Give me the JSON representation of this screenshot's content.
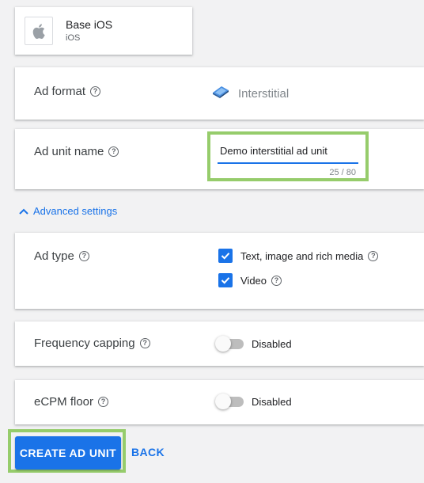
{
  "app": {
    "name": "Base iOS",
    "platform": "iOS",
    "icon": "apple-icon"
  },
  "ad_format": {
    "label": "Ad format",
    "value": "Interstitial",
    "icon": "interstitial-icon"
  },
  "ad_unit_name": {
    "label": "Ad unit name",
    "value": "Demo interstitial ad unit",
    "counter": "25 / 80"
  },
  "advanced_settings": {
    "label": "Advanced settings"
  },
  "ad_type": {
    "label": "Ad type",
    "options": [
      {
        "label": "Text, image and rich media",
        "checked": true
      },
      {
        "label": "Video",
        "checked": true
      }
    ]
  },
  "frequency_capping": {
    "label": "Frequency capping",
    "state": "Disabled"
  },
  "ecpm_floor": {
    "label": "eCPM floor",
    "state": "Disabled"
  },
  "actions": {
    "create_label": "CREATE AD UNIT",
    "back_label": "BACK"
  },
  "colors": {
    "accent": "#1a73e8",
    "highlight": "#96cc6b"
  }
}
